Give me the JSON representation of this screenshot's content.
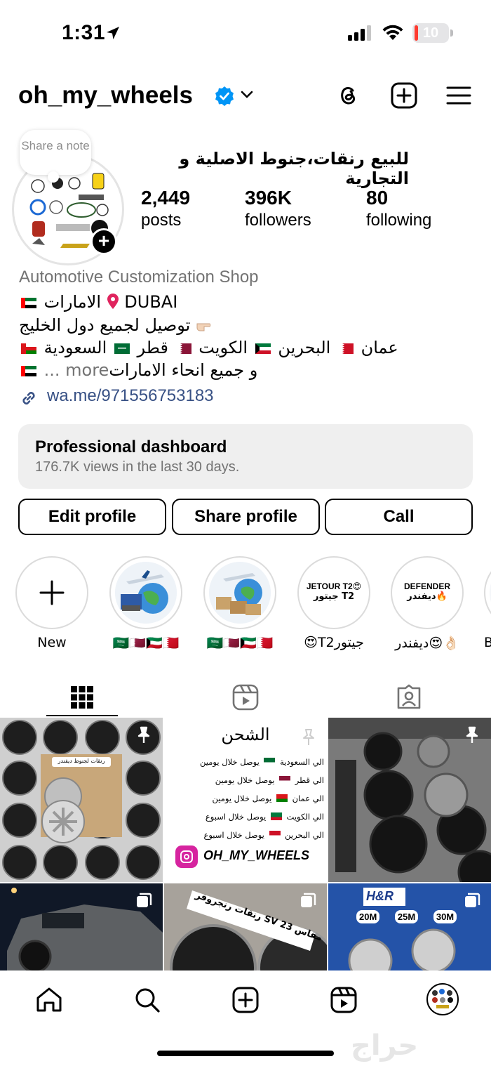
{
  "status_bar": {
    "time": "1:31",
    "battery": "10",
    "battery_level": 0.1
  },
  "header": {
    "username": "oh_my_wheels",
    "icons": [
      "threads-icon",
      "new-post-icon",
      "menu-icon"
    ]
  },
  "profile": {
    "note_placeholder": "Share a note",
    "display_name": "للبيع رنقات،جنوط الاصلية و التجارية",
    "stats": [
      {
        "value": "2,449",
        "label": "posts"
      },
      {
        "value": "396K",
        "label": "followers"
      },
      {
        "value": "80",
        "label": "following"
      }
    ],
    "category": "Automotive Customization Shop",
    "bio": {
      "line1_text": "الامارات",
      "line1_city": "DUBAI",
      "line2": "توصيل لجميع دول الخليج",
      "line3": [
        "السعودية",
        "قطر",
        "الكويت",
        "البحرين",
        "عمان"
      ],
      "line4": "و جميع انحاء الامارات",
      "more": "... more"
    },
    "link": "wa.me/971556753183"
  },
  "dashboard": {
    "title": "Professional dashboard",
    "subtitle": "176.7K views in the last 30 days."
  },
  "buttons": {
    "edit": "Edit profile",
    "share": "Share profile",
    "call": "Call"
  },
  "highlights": [
    {
      "label": "New"
    },
    {
      "label": "🇸🇦🇶🇦🇰🇼🇧🇭"
    },
    {
      "label": "🇸🇦🇶🇦🇰🇼🇧🇭"
    },
    {
      "label": "😍T2جيتور",
      "cover_top": "JETOUR T2😍",
      "cover_bottom": "جيتور T2"
    },
    {
      "label": "ديفندر😍👌🏻",
      "cover_top": "DEFENDER",
      "cover_bottom": "ديفندر🔥"
    },
    {
      "label": "B"
    }
  ],
  "grid": {
    "post2_title": "الشحن",
    "post2_rows": [
      {
        "country": "الي السعودية",
        "time": "يوصل خلال يومين"
      },
      {
        "country": "الي قطر",
        "time": "يوصل خلال يومين"
      },
      {
        "country": "الي عمان",
        "time": "يوصل خلال يومين"
      },
      {
        "country": "الي الكويت",
        "time": "يوصل خلال اسبوع"
      },
      {
        "country": "الي البحرين",
        "time": "يوصل خلال اسبوع"
      }
    ],
    "post2_brand": "OH_MY_WHEELS",
    "post1_tag": "رنقات لجنوط ديفندر",
    "post5_tag": "رنقات رنجروفر SV مقاس 23",
    "post6_sizes": [
      "20M",
      "25M",
      "30M"
    ],
    "post6_brand": "H&R"
  },
  "watermark": "حراج",
  "colors": {
    "accent": "#0095f6",
    "link": "#385185",
    "secondary": "#737373"
  }
}
